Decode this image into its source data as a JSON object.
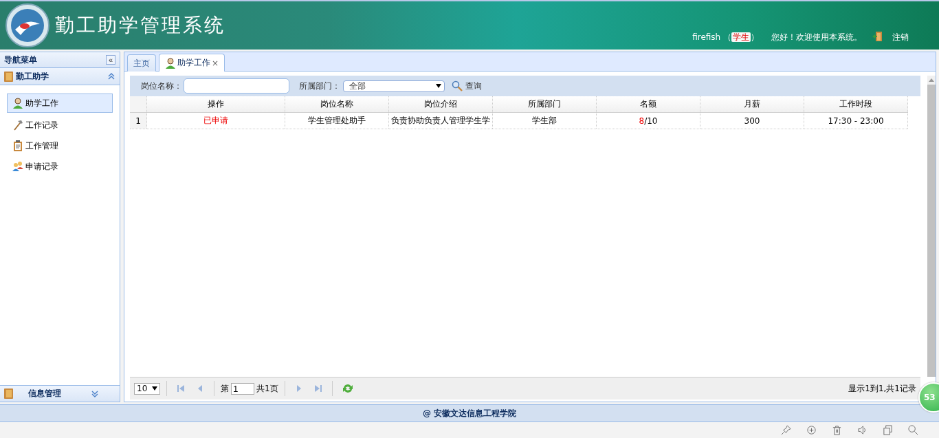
{
  "header": {
    "title": "勤工助学管理系统",
    "user": "firefish",
    "role_open": "（",
    "role": "学生",
    "role_close": "）",
    "welcome": "您好！欢迎使用本系统。",
    "logout": "注销"
  },
  "sidebar": {
    "title": "导航菜单",
    "collapse": "«",
    "panels": [
      {
        "title": "勤工助学",
        "expanded": true,
        "items": [
          {
            "label": "助学工作",
            "kind": "person",
            "selected": true
          },
          {
            "label": "工作记录",
            "kind": "hammer",
            "selected": false
          },
          {
            "label": "工作管理",
            "kind": "clipboard",
            "selected": false
          },
          {
            "label": "申请记录",
            "kind": "users",
            "selected": false
          }
        ]
      },
      {
        "title": "信息管理",
        "expanded": false
      }
    ]
  },
  "tabs": [
    {
      "label": "主页",
      "selected": false,
      "closable": false
    },
    {
      "label": "助学工作",
      "selected": true,
      "closable": true
    }
  ],
  "tab_close": "×",
  "filter": {
    "name_label": "岗位名称：",
    "dept_label": "所属部门：",
    "dept_value": "全部",
    "search": "查询"
  },
  "table": {
    "columns": [
      "操作",
      "岗位名称",
      "岗位介绍",
      "所属部门",
      "名额",
      "月薪",
      "工作时段"
    ],
    "rows": [
      {
        "number": "1",
        "action": "已申请",
        "name": "学生管理处助手",
        "intro": "负责协助负责人管理学生学",
        "department": "学生部",
        "quota_taken": "8",
        "quota_total": "/10",
        "salary": "300",
        "hours": "17:30 - 23:00"
      }
    ]
  },
  "pager": {
    "page_size": "10",
    "page_prefix": "第",
    "page": "1",
    "page_suffix": "共1页",
    "summary": "显示1到1,共1记录"
  },
  "footer": "@ 安徽文达信息工程学院",
  "badge": "53"
}
